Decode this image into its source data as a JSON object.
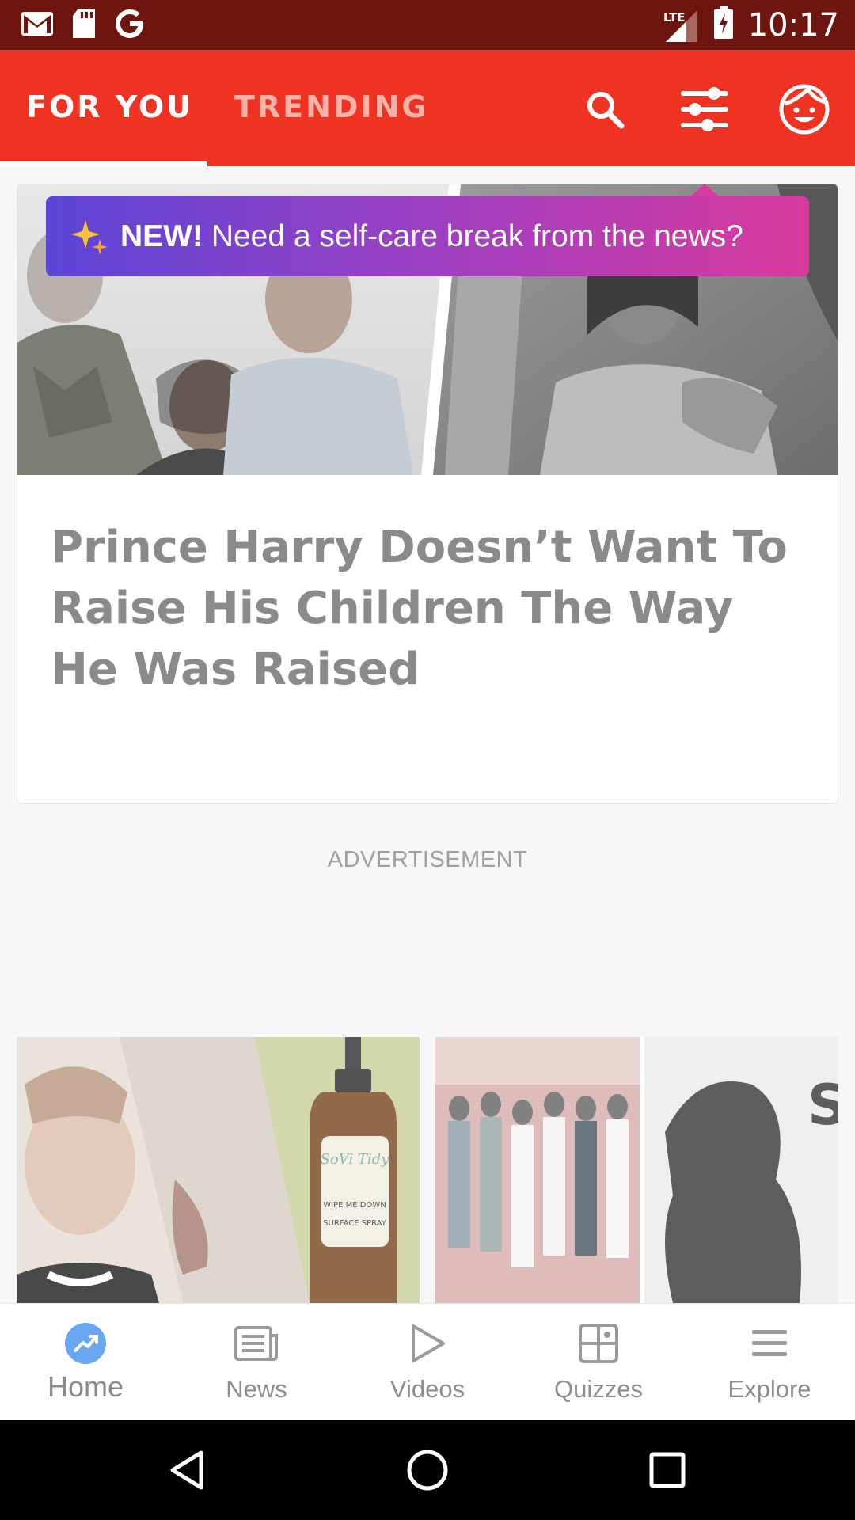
{
  "status_bar": {
    "time": "10:17",
    "network": "LTE",
    "icons": [
      "gmail-icon",
      "sd-card-icon",
      "google-icon",
      "signal-icon",
      "battery-icon"
    ]
  },
  "header": {
    "tabs": [
      {
        "label": "FOR YOU",
        "active": true
      },
      {
        "label": "TRENDING",
        "active": false
      }
    ],
    "actions": [
      "search-icon",
      "filter-icon",
      "profile-icon"
    ],
    "accent_color": "#ee3322"
  },
  "tooltip": {
    "new_label": "NEW!",
    "text": "Need a self-care break from the news?"
  },
  "feed": {
    "featured_title": "Prince Harry Doesn’t Want To Raise His Children The Way He Was Raised",
    "ad_label": "ADVERTISEMENT",
    "thumbnail_text": {
      "bottle_brand": "SoVi Tidy",
      "bottle_line1": "WIPE ME DOWN",
      "bottle_line2": "SURFACE SPRAY",
      "magazine_letters": "SW IT"
    }
  },
  "bottom_nav": {
    "items": [
      {
        "label": "Home",
        "icon": "trending-icon",
        "active": true
      },
      {
        "label": "News",
        "icon": "newspaper-icon",
        "active": false
      },
      {
        "label": "Videos",
        "icon": "play-icon",
        "active": false
      },
      {
        "label": "Quizzes",
        "icon": "quiz-grid-icon",
        "active": false
      },
      {
        "label": "Explore",
        "icon": "menu-icon",
        "active": false
      }
    ]
  },
  "system_nav": [
    "back-icon",
    "home-circle-icon",
    "recents-icon"
  ]
}
